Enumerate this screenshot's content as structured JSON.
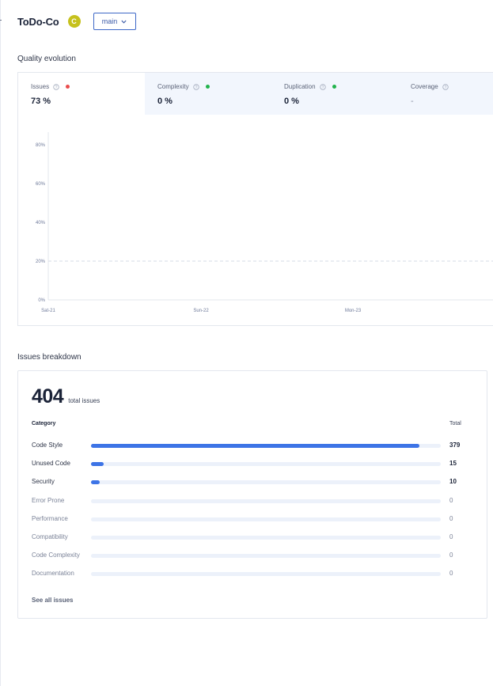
{
  "header": {
    "project_name": "ToDo-Co",
    "grade": "C",
    "branch": "main"
  },
  "quality": {
    "title": "Quality evolution",
    "tabs": [
      {
        "label": "Issues",
        "value": "73 %",
        "status": "red"
      },
      {
        "label": "Complexity",
        "value": "0 %",
        "status": "green"
      },
      {
        "label": "Duplication",
        "value": "0 %",
        "status": "green"
      },
      {
        "label": "Coverage",
        "value": "-",
        "status": "none"
      }
    ],
    "colors": {
      "red": "#ea4d4d",
      "green": "#22b34d",
      "accent": "#3d74e6"
    }
  },
  "chart_data": {
    "type": "line",
    "x": [
      "Sat-21",
      "Sun-22",
      "Mon-23"
    ],
    "y_ticks": [
      "80%",
      "60%",
      "40%",
      "20%",
      "0%"
    ],
    "ylim": [
      0,
      80
    ],
    "threshold": 20,
    "grid": false
  },
  "breakdown": {
    "title": "Issues breakdown",
    "total": "404",
    "total_label": "total issues",
    "category_header": "Category",
    "total_header": "Total",
    "max": 404,
    "rows": [
      {
        "name": "Code Style",
        "count": "379",
        "value": 379
      },
      {
        "name": "Unused Code",
        "count": "15",
        "value": 15
      },
      {
        "name": "Security",
        "count": "10",
        "value": 10
      },
      {
        "name": "Error Prone",
        "count": "0",
        "value": 0
      },
      {
        "name": "Performance",
        "count": "0",
        "value": 0
      },
      {
        "name": "Compatibility",
        "count": "0",
        "value": 0
      },
      {
        "name": "Code Complexity",
        "count": "0",
        "value": 0
      },
      {
        "name": "Documentation",
        "count": "0",
        "value": 0
      }
    ],
    "see_all": "See all issues"
  }
}
